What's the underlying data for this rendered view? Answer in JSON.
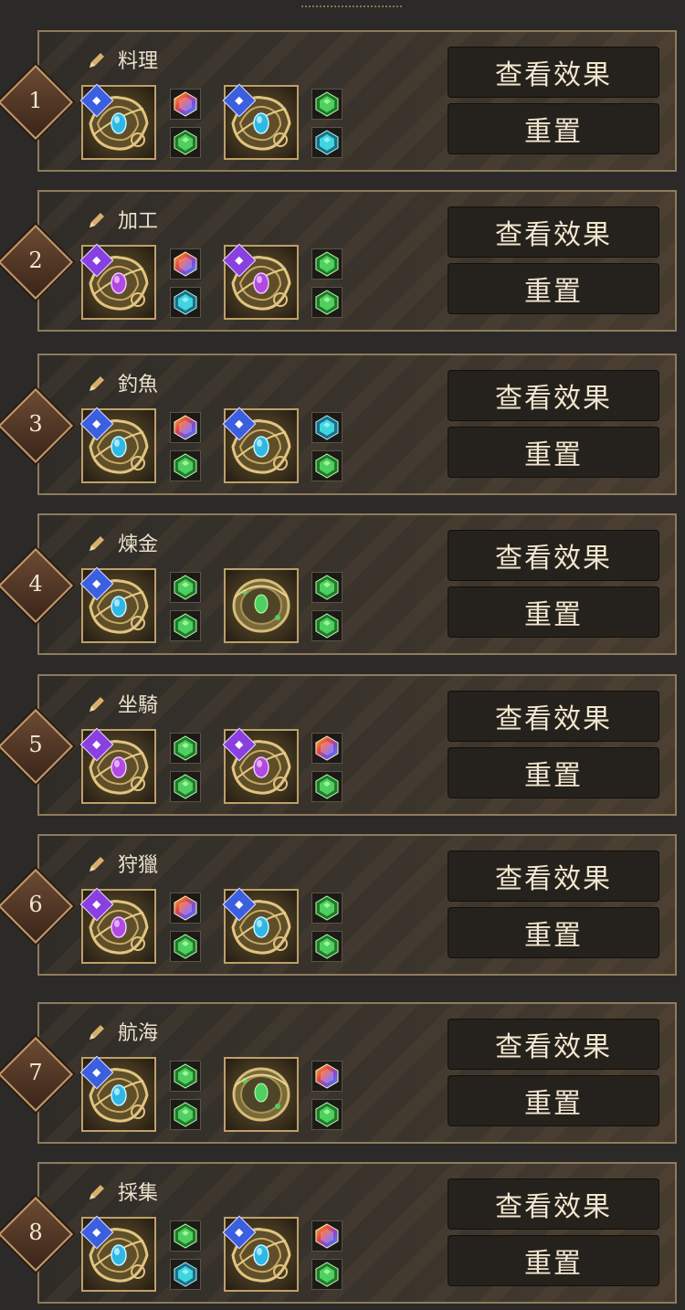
{
  "buttons": {
    "view_effect": "查看效果",
    "reset": "重置"
  },
  "colors": {
    "blue_badge": "#3c5fe0",
    "purple_badge": "#8a3fe0",
    "gold_frame": "#bda06a"
  },
  "slots": [
    {
      "number": "1",
      "title": "料理",
      "ring_a": {
        "style": "blue",
        "badge": "blue",
        "icon": "cooking-icon"
      },
      "gems_a": [
        "rainbow",
        "green"
      ],
      "ring_b": {
        "style": "blue",
        "badge": "blue",
        "icon": "cooking-icon"
      },
      "gems_b": [
        "green",
        "cyan"
      ]
    },
    {
      "number": "2",
      "title": "加工",
      "ring_a": {
        "style": "purple",
        "badge": "purple",
        "icon": "processing-icon"
      },
      "gems_a": [
        "rainbow",
        "cyan"
      ],
      "ring_b": {
        "style": "purple",
        "badge": "purple",
        "icon": "processing-icon"
      },
      "gems_b": [
        "green",
        "green"
      ]
    },
    {
      "number": "3",
      "title": "釣魚",
      "ring_a": {
        "style": "blue",
        "badge": "blue",
        "icon": "fishing-icon"
      },
      "gems_a": [
        "rainbow",
        "green"
      ],
      "ring_b": {
        "style": "blue",
        "badge": "blue",
        "icon": "fishing-icon"
      },
      "gems_b": [
        "cyan",
        "green"
      ]
    },
    {
      "number": "4",
      "title": "煉金",
      "ring_a": {
        "style": "blue",
        "badge": "blue",
        "icon": "alchemy-icon"
      },
      "gems_a": [
        "green",
        "green"
      ],
      "ring_b": {
        "style": "green",
        "badge": "",
        "icon": "green-ring-icon"
      },
      "gems_b": [
        "green",
        "green"
      ]
    },
    {
      "number": "5",
      "title": "坐騎",
      "ring_a": {
        "style": "purple",
        "badge": "purple",
        "icon": "horse-icon"
      },
      "gems_a": [
        "green",
        "green"
      ],
      "ring_b": {
        "style": "purple",
        "badge": "purple",
        "icon": "horse-icon"
      },
      "gems_b": [
        "rainbow",
        "green"
      ]
    },
    {
      "number": "6",
      "title": "狩獵",
      "ring_a": {
        "style": "purple",
        "badge": "purple",
        "icon": "hunting-icon"
      },
      "gems_a": [
        "rainbow",
        "green"
      ],
      "ring_b": {
        "style": "blue",
        "badge": "blue",
        "icon": "hunting-icon"
      },
      "gems_b": [
        "green",
        "green"
      ]
    },
    {
      "number": "7",
      "title": "航海",
      "ring_a": {
        "style": "blue",
        "badge": "blue",
        "icon": "anchor-icon"
      },
      "gems_a": [
        "green",
        "green"
      ],
      "ring_b": {
        "style": "green",
        "badge": "",
        "icon": "green-ring-icon"
      },
      "gems_b": [
        "rainbow",
        "green"
      ]
    },
    {
      "number": "8",
      "title": "採集",
      "ring_a": {
        "style": "blue",
        "badge": "blue",
        "icon": "gathering-icon"
      },
      "gems_a": [
        "green",
        "cyan"
      ],
      "ring_b": {
        "style": "blue",
        "badge": "blue",
        "icon": "gathering-icon"
      },
      "gems_b": [
        "rainbow",
        "green"
      ]
    }
  ]
}
